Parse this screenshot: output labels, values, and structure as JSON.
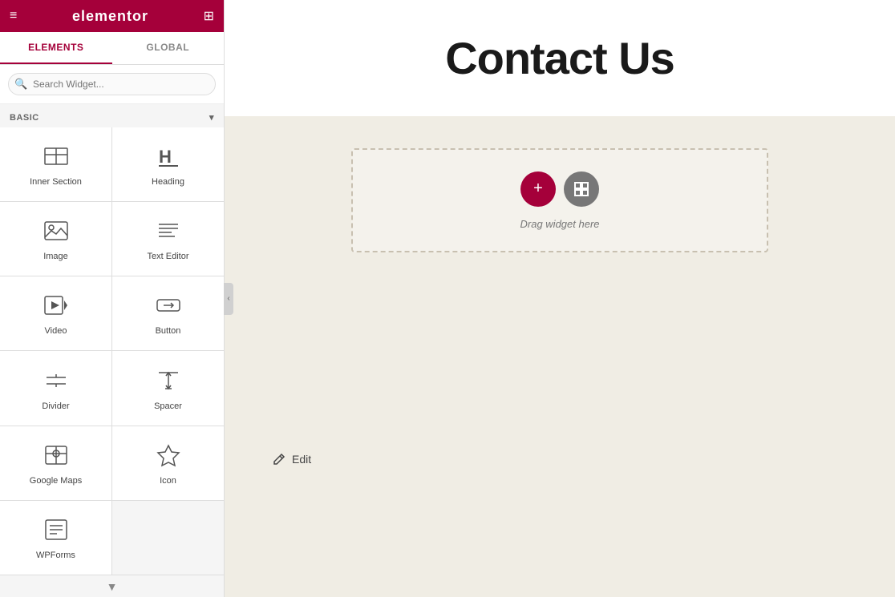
{
  "header": {
    "logo": "elementor",
    "menu_icon": "≡",
    "grid_icon": "⊞"
  },
  "tabs": [
    {
      "id": "elements",
      "label": "ELEMENTS",
      "active": true
    },
    {
      "id": "global",
      "label": "GLOBAL",
      "active": false
    }
  ],
  "search": {
    "placeholder": "Search Widget..."
  },
  "section": {
    "label": "BASIC",
    "collapse_icon": "▾"
  },
  "widgets": [
    {
      "id": "inner-section",
      "label": "Inner Section",
      "icon": "inner-section-icon"
    },
    {
      "id": "heading",
      "label": "Heading",
      "icon": "heading-icon"
    },
    {
      "id": "image",
      "label": "Image",
      "icon": "image-icon"
    },
    {
      "id": "text-editor",
      "label": "Text Editor",
      "icon": "text-editor-icon"
    },
    {
      "id": "video",
      "label": "Video",
      "icon": "video-icon"
    },
    {
      "id": "button",
      "label": "Button",
      "icon": "button-icon"
    },
    {
      "id": "divider",
      "label": "Divider",
      "icon": "divider-icon"
    },
    {
      "id": "spacer",
      "label": "Spacer",
      "icon": "spacer-icon"
    },
    {
      "id": "google-maps",
      "label": "Google Maps",
      "icon": "google-maps-icon"
    },
    {
      "id": "icon",
      "label": "Icon",
      "icon": "icon-icon"
    },
    {
      "id": "wpforms",
      "label": "WPForms",
      "icon": "wpforms-icon"
    }
  ],
  "canvas": {
    "page_title": "Contact Us",
    "drop_zone_text": "Drag widget here",
    "edit_label": "Edit"
  },
  "buttons": {
    "add_icon": "+",
    "grid_icon": "⊟"
  }
}
